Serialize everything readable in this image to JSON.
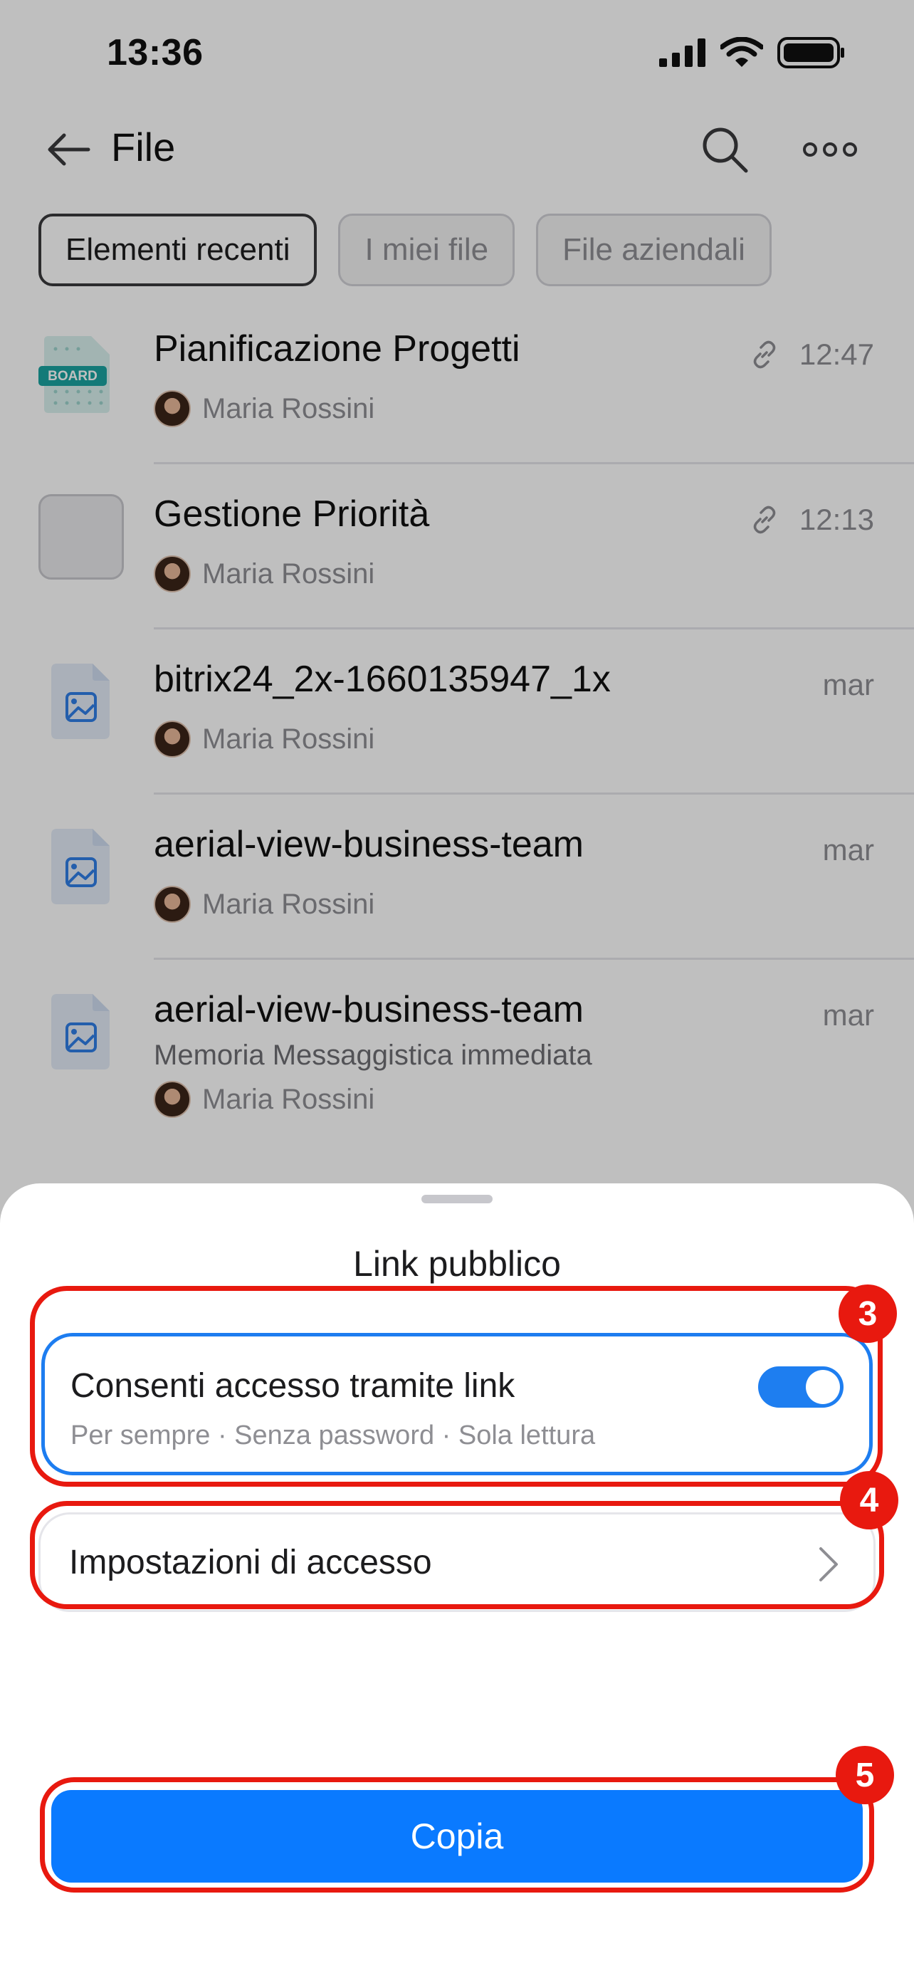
{
  "status_bar": {
    "time": "13:36",
    "icons": [
      "signal-icon",
      "wifi-icon",
      "battery-icon"
    ]
  },
  "nav": {
    "title": "File",
    "icons": [
      "back-arrow-icon",
      "search-icon",
      "more-icon"
    ]
  },
  "filters": [
    {
      "label": "Elementi recenti",
      "active": true
    },
    {
      "label": "I miei file",
      "active": false
    },
    {
      "label": "File aziendali",
      "active": false
    }
  ],
  "files": [
    {
      "name": "Pianificazione Progetti",
      "thumb": "board",
      "thumb_label": "BOARD",
      "owner": "Maria Rossini",
      "time": "12:47",
      "link": true,
      "subtitle": ""
    },
    {
      "name": "Gestione Priorità",
      "thumb": "blank",
      "thumb_label": "",
      "owner": "Maria Rossini",
      "time": "12:13",
      "link": true,
      "subtitle": ""
    },
    {
      "name": "bitrix24_2x-1660135947_1x",
      "thumb": "image",
      "thumb_label": "",
      "owner": "Maria Rossini",
      "time": "mar",
      "link": false,
      "subtitle": ""
    },
    {
      "name": "aerial-view-business-team",
      "thumb": "image",
      "thumb_label": "",
      "owner": "Maria Rossini",
      "time": "mar",
      "link": false,
      "subtitle": ""
    },
    {
      "name": "aerial-view-business-team",
      "thumb": "image",
      "thumb_label": "",
      "owner": "Maria Rossini",
      "time": "mar",
      "link": false,
      "subtitle": "Memoria Messaggistica immediata"
    }
  ],
  "sheet": {
    "title": "Link pubblico",
    "access_title": "Consenti accesso tramite link",
    "access_subtitle": "Per sempre · Senza password · Sola lettura",
    "access_enabled": true,
    "settings_label": "Impostazioni di accesso",
    "copy_label": "Copia"
  },
  "annotations": [
    "3",
    "4",
    "5"
  ],
  "colors": {
    "accent": "#0a7aff",
    "toggle_on": "#1e7ef0",
    "highlight": "#e8190f"
  }
}
